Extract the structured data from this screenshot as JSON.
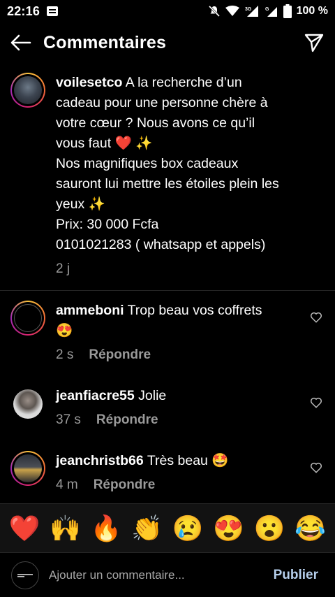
{
  "status_bar": {
    "time": "22:16",
    "network": "3G",
    "battery": "100 %"
  },
  "header": {
    "title": "Commentaires"
  },
  "post": {
    "username": "voilesetco",
    "lines": [
      "A la recherche d’un",
      "cadeau pour une personne chère à",
      "votre cœur ? Nous avons ce qu’il",
      "vous faut ❤️ ✨",
      "Nos magnifiques box cadeaux",
      "sauront lui mettre les étoiles plein les",
      "yeux ✨",
      "Prix: 30 000 Fcfa",
      "0101021283 ( whatsapp et appels)"
    ],
    "time": "2 j"
  },
  "comments": [
    {
      "username": "ammeboni",
      "text": "Trop beau vos coffrets",
      "text2": "😍",
      "time": "2 s",
      "reply": "Répondre"
    },
    {
      "username": "jeanfiacre55",
      "text": "Jolie",
      "time": "37 s",
      "reply": "Répondre"
    },
    {
      "username": "jeanchristb66",
      "text": "Très beau 🤩",
      "time": "4 m",
      "reply": "Répondre"
    }
  ],
  "emoji_bar": [
    "❤️",
    "🙌",
    "🔥",
    "👏",
    "😢",
    "😍",
    "😮",
    "😂"
  ],
  "input": {
    "placeholder": "Ajouter un commentaire...",
    "publish": "Publier"
  },
  "icons": {
    "back": "arrow-left-icon",
    "send": "paper-plane-icon",
    "heart": "heart-outline-icon"
  }
}
